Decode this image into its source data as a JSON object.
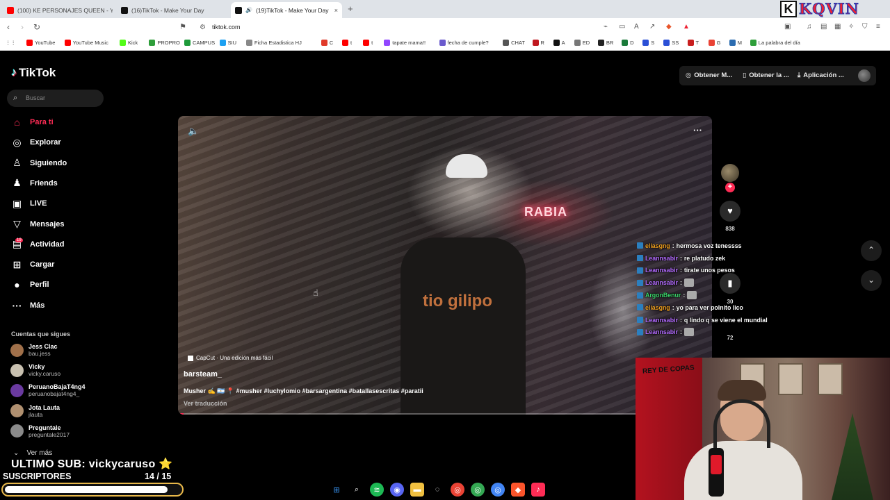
{
  "browser": {
    "tabs": [
      {
        "title": "(100) KE PERSONAJES QUEEN - YouT",
        "color": "#ff0000"
      },
      {
        "title": "(16)TikTok - Make Your Day",
        "color": "#111111"
      },
      {
        "title": "(19)TikTok - Make Your Day",
        "color": "#111111",
        "active": true
      }
    ],
    "close_label": "×",
    "new_tab_label": "+",
    "brand_k": "K",
    "brand_name": "KQVIN",
    "url": "tiktok.com",
    "bookmarks": [
      {
        "label": "YouTube",
        "color": "#ff0000"
      },
      {
        "label": "YouTube Music",
        "color": "#ff0000"
      },
      {
        "label": "Kick",
        "color": "#53fc18"
      },
      {
        "label": "PROPRO",
        "color": "#2e9e3a"
      },
      {
        "label": "CAMPUS",
        "color": "#1e9a3a"
      },
      {
        "label": "SIU",
        "color": "#1da1f2"
      },
      {
        "label": "Ficha Estadistica HJ",
        "color": "#888888"
      },
      {
        "label": "C",
        "color": "#e03a2a"
      },
      {
        "label": "t",
        "color": "#ff0000"
      },
      {
        "label": "t",
        "color": "#ff0000"
      },
      {
        "label": "tapate mama!!",
        "color": "#9146ff"
      },
      {
        "label": "fecha de cumple?",
        "color": "#6a5acd"
      },
      {
        "label": "CHAT",
        "color": "#555555"
      },
      {
        "label": "R",
        "color": "#c0181f"
      },
      {
        "label": "A",
        "color": "#111111"
      },
      {
        "label": "ED",
        "color": "#777777"
      },
      {
        "label": "BR",
        "color": "#222222"
      },
      {
        "label": "D",
        "color": "#1a7a3a"
      },
      {
        "label": "S",
        "color": "#2a4fd6"
      },
      {
        "label": "SS",
        "color": "#2a4fd6"
      },
      {
        "label": "T",
        "color": "#c81e1e"
      },
      {
        "label": "G",
        "color": "#ea4335"
      },
      {
        "label": "M",
        "color": "#2b6cb0"
      },
      {
        "label": "La palabra del día",
        "color": "#2e9e3a"
      }
    ]
  },
  "tiktok": {
    "logo": "TikTok",
    "search_placeholder": "Buscar",
    "nav": [
      {
        "label": "Para ti",
        "icon": "home-icon",
        "active": true
      },
      {
        "label": "Explorar",
        "icon": "compass-icon"
      },
      {
        "label": "Siguiendo",
        "icon": "user-follow-icon"
      },
      {
        "label": "Friends",
        "icon": "friends-icon"
      },
      {
        "label": "LIVE",
        "icon": "live-icon"
      },
      {
        "label": "Mensajes",
        "icon": "message-icon"
      },
      {
        "label": "Actividad",
        "icon": "activity-icon"
      },
      {
        "label": "Cargar",
        "icon": "upload-icon"
      },
      {
        "label": "Perfil",
        "icon": "profile-icon"
      },
      {
        "label": "Más",
        "icon": "more-icon"
      }
    ],
    "activity_badge": "19",
    "followed_title": "Cuentas que sigues",
    "followed": [
      {
        "name": "Jess Clac",
        "handle": "bau.jess"
      },
      {
        "name": "Vicky",
        "handle": "vicky.caruso"
      },
      {
        "name": "PeruanoBajaT4ng4",
        "handle": "peruanobajat4ng4_"
      },
      {
        "name": "Jota Lauta",
        "handle": "jlauta"
      },
      {
        "name": "Preguntale",
        "handle": "preguntale2017"
      }
    ],
    "see_more": "Ver más",
    "top_buttons": [
      "Obtener M...",
      "Obtener la ...",
      "Aplicación ..."
    ],
    "video": {
      "neon_sign": "RABIA",
      "shirt_text": "tio gilipo",
      "capcut": "CapCut · Una edición más fácil",
      "author": "barsteam_",
      "caption": "Musher ✍️ 🇦🇷 📍 #musher #luchylomio #barsargentina #batallasescritas #paratii",
      "translate": "Ver traducción",
      "progress": 0.01
    },
    "rail": {
      "likes": "838",
      "comments": "30",
      "shares": "72"
    }
  },
  "stream": {
    "chat": [
      {
        "user": "eliasgng",
        "color": "#f0a020",
        "msg": "hermosa voz tenessss"
      },
      {
        "user": "Leannsabir",
        "color": "#b36bff",
        "msg": "re platudo zek"
      },
      {
        "user": "Leannsabir",
        "color": "#b36bff",
        "msg": "tirate unos pesos"
      },
      {
        "user": "Leannsabir",
        "color": "#b36bff",
        "msg": ""
      },
      {
        "user": "ArgonBenur",
        "color": "#3ad46a",
        "msg": ""
      },
      {
        "user": "eliasgng",
        "color": "#f0a020",
        "msg": "yo para ver polnito lico"
      },
      {
        "user": "Leannsabir",
        "color": "#b36bff",
        "msg": "q lindo q se viene el mundial"
      },
      {
        "user": "Leannsabir",
        "color": "#b36bff",
        "msg": ""
      }
    ],
    "last_sub_label": "ULTIMO SUB: vickycaruso ⭐",
    "subs_label": "SUSCRIPTORES",
    "subs_count": "14  / 15",
    "subs_progress": 0.93,
    "flag_text": "REY DE COPAS"
  }
}
